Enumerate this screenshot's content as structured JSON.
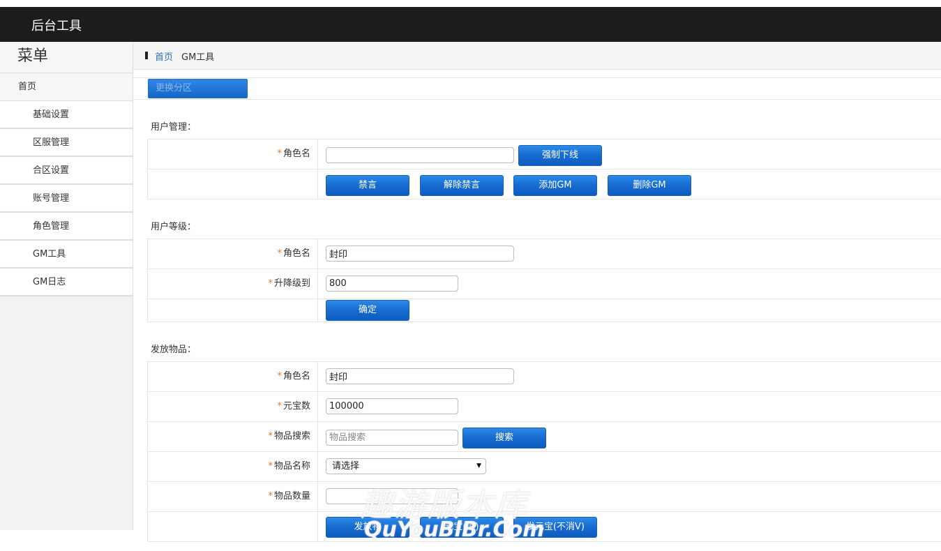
{
  "header": {
    "app_title": "后台工具"
  },
  "sidebar": {
    "menu_title": "菜单",
    "home_label": "首页",
    "items": [
      {
        "label": "基础设置"
      },
      {
        "label": "区服管理"
      },
      {
        "label": "合区设置"
      },
      {
        "label": "账号管理"
      },
      {
        "label": "角色管理"
      },
      {
        "label": "GM工具"
      },
      {
        "label": "GM日志"
      }
    ]
  },
  "breadcrumb": {
    "home": "首页",
    "current": "GM工具"
  },
  "toolbar": {
    "switch_zone_label": "更换分区"
  },
  "user_management": {
    "section_title": "用户管理：",
    "role_label": "角色名",
    "role_value": "",
    "force_offline_label": "强制下线",
    "actions": {
      "mute": "禁言",
      "unmute": "解除禁言",
      "add_gm": "添加GM",
      "remove_gm": "删除GM"
    }
  },
  "user_level": {
    "section_title": "用户等级：",
    "role_label": "角色名",
    "role_value": "封印",
    "level_label": "升降级到",
    "level_value": "800",
    "confirm_label": "确定"
  },
  "send_items": {
    "section_title": "发放物品：",
    "role_label": "角色名",
    "role_value": "封印",
    "ingot_label": "元宝数",
    "ingot_value": "100000",
    "search_label": "物品搜索",
    "search_placeholder": "物品搜索",
    "search_button": "搜索",
    "item_name_label": "物品名称",
    "item_name_selected": "请选择",
    "item_qty_label": "物品数量",
    "item_qty_value": "",
    "send_item_button": "发放物",
    "send_ingot_consume_button": "元宝(消)",
    "send_ingot_noconsume_button": "发元宝(不消V)"
  },
  "watermark": {
    "cn": "趣游版本库",
    "en": "QuYouBlBr.Com"
  },
  "colors": {
    "topbar": "#1c1c1c",
    "accent_button": "#176bd0",
    "required_star": "#e07b1a",
    "link": "#2a73b5"
  }
}
